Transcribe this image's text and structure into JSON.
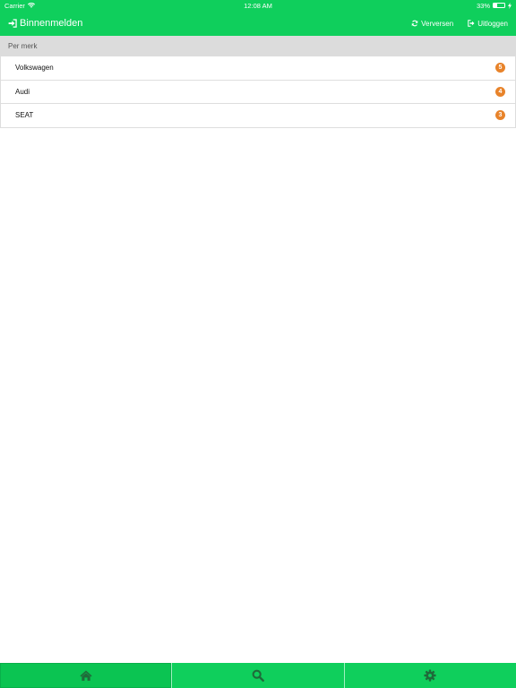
{
  "status_bar": {
    "carrier": "Carrier",
    "wifi_icon": "wifi-icon",
    "time": "12:08 AM",
    "battery_percent": "33%",
    "battery_level": 0.33,
    "charging_icon": "charging-icon"
  },
  "nav": {
    "title": "Binnenmelden",
    "title_icon": "sign-in-icon",
    "refresh_label": "Verversen",
    "refresh_icon": "refresh-icon",
    "logout_label": "Uitloggen",
    "logout_icon": "sign-out-icon"
  },
  "section": {
    "header": "Per merk"
  },
  "brands": [
    {
      "name": "Volkswagen",
      "count": "5"
    },
    {
      "name": "Audi",
      "count": "4"
    },
    {
      "name": "SEAT",
      "count": "3"
    }
  ],
  "tabbar": {
    "tabs": [
      {
        "icon": "home-icon",
        "active": true
      },
      {
        "icon": "search-icon",
        "active": false
      },
      {
        "icon": "gear-icon",
        "active": false
      }
    ]
  },
  "colors": {
    "primary": "#0fcf5c",
    "badge": "#e8832a",
    "section_bg": "#dcdcdc"
  }
}
